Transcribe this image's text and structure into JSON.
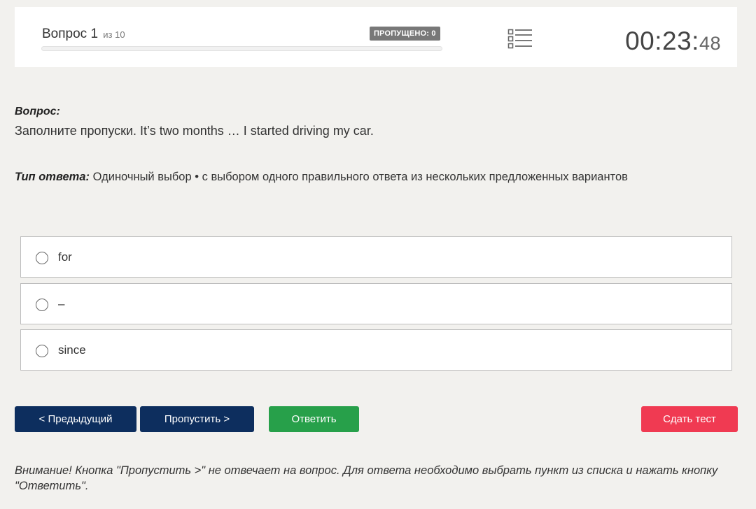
{
  "header": {
    "question_label": "Вопрос 1",
    "question_of": "из 10",
    "progress": 0,
    "skipped_label": "ПРОПУЩЕНО: 0",
    "questions_list_icon": "list-icon",
    "timer_main": "00:23:",
    "timer_seconds": "48"
  },
  "question": {
    "label": "Вопрос:",
    "text": "Заполните пропуски. It’s two months … I started driving my car."
  },
  "answer_type": {
    "label": "Тип ответа:",
    "value": "Одиночный выбор • с выбором одного правильного ответа из нескольких предложенных вариантов"
  },
  "options": [
    {
      "label": "for"
    },
    {
      "label": "–"
    },
    {
      "label": "since"
    }
  ],
  "buttons": {
    "prev": "< Предыдущий",
    "skip": "Пропустить >",
    "answer": "Ответить",
    "submit": "Сдать тест"
  },
  "notice": "Внимание! Кнопка \"Пропустить >\" не отвечает на вопрос. Для ответа необходимо выбрать пункт из списка и нажать кнопку \"Ответить\".",
  "colors": {
    "nav_button": "#0d2e5e",
    "answer_button": "#27a04a",
    "submit_button": "#f03a52",
    "badge": "#787878"
  }
}
